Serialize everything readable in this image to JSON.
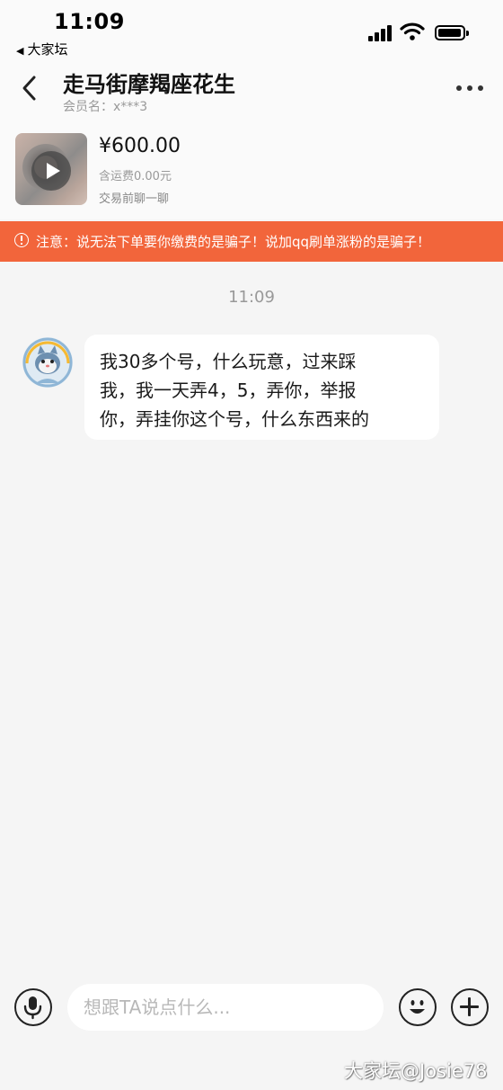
{
  "status_bar": {
    "time": "11:09",
    "back_app": "大家坛",
    "icons": [
      "signal-icon",
      "wifi-icon",
      "battery-icon"
    ]
  },
  "header": {
    "title": "走马街摩羯座花生",
    "member_label": "会员名：x***3",
    "icons": [
      "back-arrow-icon",
      "more-icon"
    ]
  },
  "product": {
    "price": "¥600.00",
    "shipping": "含运费0.00元",
    "trade_hint": "交易前聊一聊",
    "thumb_icon": "play-icon"
  },
  "warning": {
    "text": "注意：说无法下单要你缴费的是骗子！说加qq刷单涨粉的是骗子！",
    "icon": "warning-icon",
    "color": "#f2653b"
  },
  "chat": {
    "time": "11:09",
    "messages": [
      {
        "sender": "other",
        "avatar_icon": "astronaut-cat-avatar",
        "lines": [
          "我30多个号，什么玩意，过来踩",
          "我，我一天弄4，5，弄你，举报",
          "你，弄挂你这个号，什么东西来的"
        ]
      }
    ]
  },
  "input_bar": {
    "placeholder": "想跟TA说点什么...",
    "value": "",
    "icons": [
      "microphone-icon",
      "emoji-icon",
      "plus-icon"
    ]
  },
  "watermark": "大家坛@Josie78"
}
